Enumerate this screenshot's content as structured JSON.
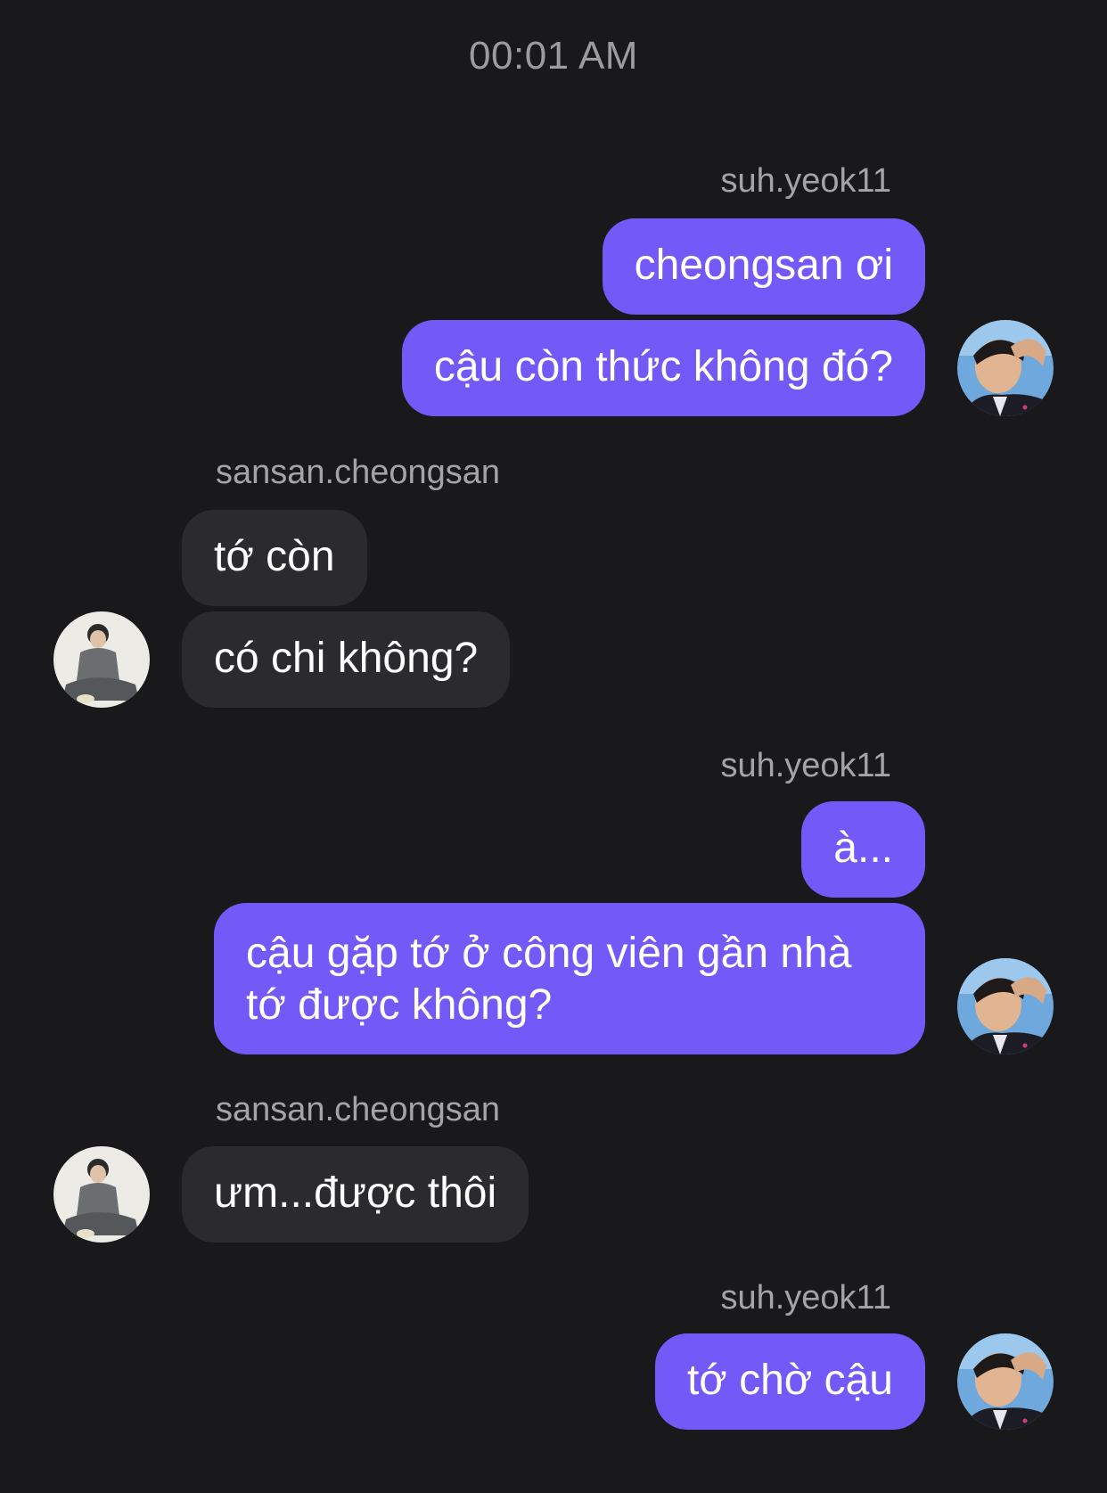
{
  "header": {
    "time": "00:01 AM"
  },
  "participants": {
    "me": "suh.yeok11",
    "other": "sansan.cheongsan"
  },
  "colors": {
    "background": "#19191b",
    "outgoing_bubble": "#7359f8",
    "incoming_bubble": "#2b2b2e",
    "sender_label": "#a4a4a8"
  },
  "messages": {
    "g1": {
      "sender": "suh.yeok11",
      "m1": "cheongsan ơi",
      "m2": "cậu còn thức không đó?"
    },
    "g2": {
      "sender": "sansan.cheongsan",
      "m1": "tớ còn",
      "m2": "có chi không?"
    },
    "g3": {
      "sender": "suh.yeok11",
      "m1": "à...",
      "m2": "cậu gặp tớ ở công viên gần nhà tớ được không?"
    },
    "g4": {
      "sender": "sansan.cheongsan",
      "m1": "ưm...được thôi"
    },
    "g5": {
      "sender": "suh.yeok11",
      "m1": "tớ chờ cậu"
    }
  }
}
